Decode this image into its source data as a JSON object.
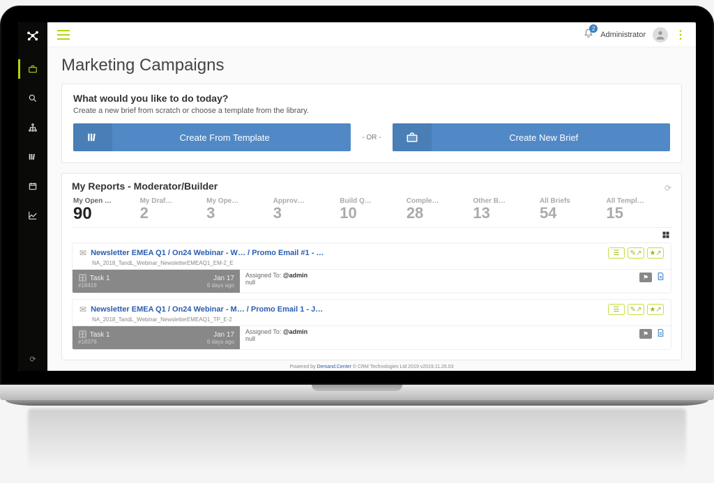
{
  "topbar": {
    "notification_count": "2",
    "user_name": "Administrator"
  },
  "page_title": "Marketing Campaigns",
  "action_card": {
    "heading": "What would you like to do today?",
    "subtext": "Create a new brief from scratch or choose a template from the library.",
    "btn_template": "Create From Template",
    "or_text": "- OR -",
    "btn_brief": "Create New Brief"
  },
  "reports": {
    "title": "My Reports - Moderator/Builder",
    "tabs": [
      {
        "label": "My Open …",
        "count": "90",
        "active": true
      },
      {
        "label": "My Draf…",
        "count": "2"
      },
      {
        "label": "My Ope…",
        "count": "3"
      },
      {
        "label": "Approv…",
        "count": "3"
      },
      {
        "label": "Build Q…",
        "count": "10"
      },
      {
        "label": "Comple…",
        "count": "28"
      },
      {
        "label": "Other B…",
        "count": "13"
      },
      {
        "label": "All Briefs",
        "count": "54"
      },
      {
        "label": "All Templ…",
        "count": "15"
      }
    ]
  },
  "briefs": [
    {
      "title": "Newsletter EMEA Q1 / On24 Webinar - W… / Promo Email #1 - …",
      "sub": "NA_2018_TandL_Webinar_NewsletterEMEAQ1_EM-2_E",
      "task_name": "Task 1",
      "task_id": "#18419",
      "task_date": "Jan 17",
      "task_age": "6 days ago",
      "assigned_label": "Assigned To:",
      "assigned_to": "@admin",
      "assigned_extra": "null"
    },
    {
      "title": "Newsletter EMEA Q1 / On24 Webinar - M… / Promo Email 1 - J…",
      "sub": "NA_2018_TandL_Webinar_NewsletterEMEAQ1_TP_E-2",
      "task_name": "Task 1",
      "task_id": "#18376",
      "task_date": "Jan 17",
      "task_age": "6 days ago",
      "assigned_label": "Assigned To:",
      "assigned_to": "@admin",
      "assigned_extra": "null"
    }
  ],
  "footer": {
    "prefix": "Powered by ",
    "link": "Demand.Center",
    "suffix": "  © CRM Technologies Ltd 2019 v2019.11.26.03"
  }
}
